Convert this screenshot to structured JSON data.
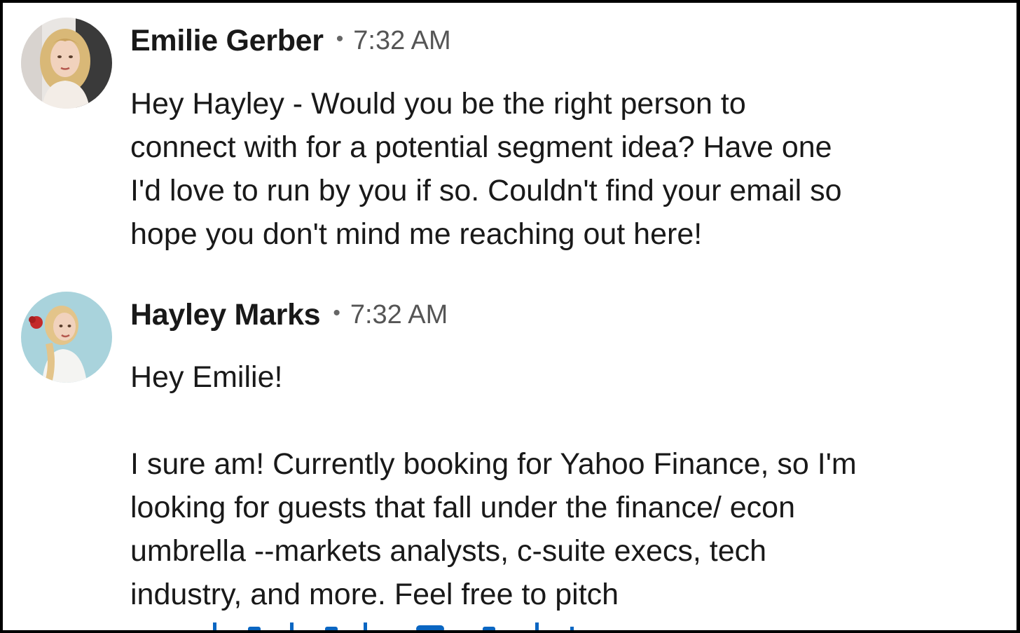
{
  "messages": [
    {
      "sender": "Emilie Gerber",
      "separator": "•",
      "time": "7:32 AM",
      "avatar": "profile-photo-emilie",
      "lines": [
        "Hey Hayley - Would you be the right person to",
        "connect with for a potential segment idea? Have one",
        "I'd love to run by you if so. Couldn't find your email so",
        "hope you don't mind me reaching out here!"
      ]
    },
    {
      "sender": "Hayley Marks",
      "separator": "•",
      "time": "7:32 AM",
      "avatar": "profile-photo-hayley",
      "greeting": "Hey Emilie!",
      "lines": [
        "I sure am! Currently booking for Yahoo Finance, so I'm",
        "looking for guests that fall under the finance/ econ",
        "umbrella --markets analysts, c-suite execs, tech",
        "industry, and more. Feel free to pitch"
      ]
    }
  ],
  "colors": {
    "frame_border": "#000000",
    "background": "#ffffff",
    "text": "#191919",
    "timestamp": "#555555",
    "link": "#0a66c2"
  }
}
